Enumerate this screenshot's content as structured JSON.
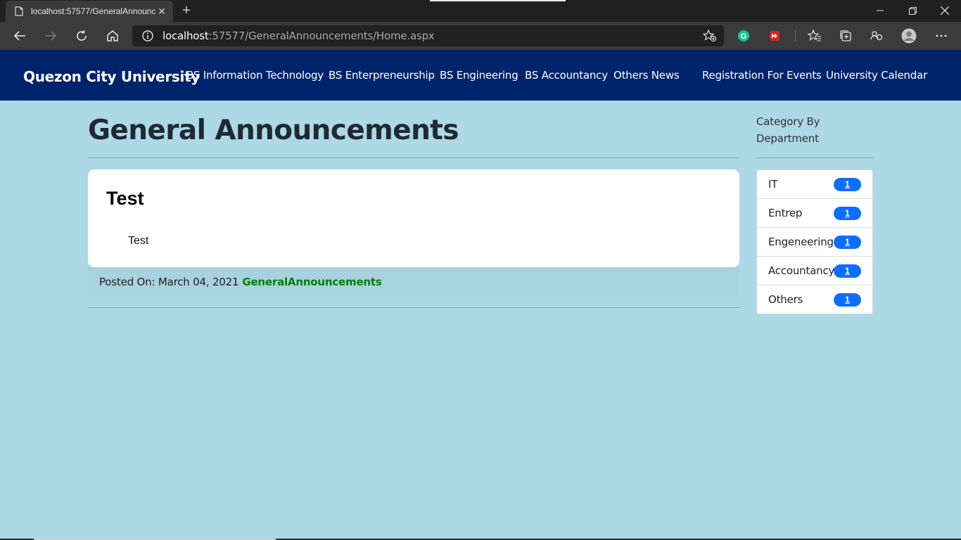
{
  "browser": {
    "tab_title": "localhost:57577/GeneralAnnouncements",
    "url_host": "localhost",
    "url_rest": ":57577/GeneralAnnouncements/Home.aspx"
  },
  "site": {
    "brand": "Quezon City University",
    "nav": [
      "BS Information Technology",
      "BS Enterpreneurship",
      "BS Engineering",
      "BS Accountancy",
      "Others News",
      "Registration For Events",
      "University Calendar"
    ]
  },
  "main": {
    "title": "General Announcements",
    "post": {
      "title": "Test",
      "body": "Test",
      "posted_label": "Posted On: March 04, 2021",
      "category": "GeneralAnnouncements"
    }
  },
  "sidebar": {
    "heading": "Category By Department",
    "categories": [
      {
        "name": "IT",
        "count": "1"
      },
      {
        "name": "Entrep",
        "count": "1"
      },
      {
        "name": "Engeneering",
        "count": "1"
      },
      {
        "name": "Accountancy",
        "count": "1"
      },
      {
        "name": "Others",
        "count": "1"
      }
    ]
  },
  "colors": {
    "page_bg": "#add8e6",
    "navbar_bg": "#00246b",
    "badge": "#0d6efd",
    "category_link": "#0a7d0a"
  }
}
